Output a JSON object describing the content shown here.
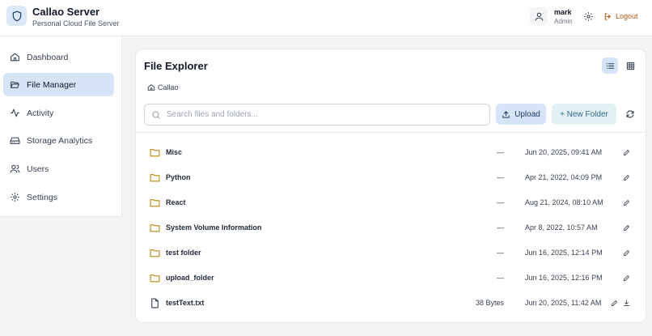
{
  "app": {
    "title": "Callao Server",
    "subtitle": "Personal Cloud File Server"
  },
  "user": {
    "name": "mark",
    "role": "Admin"
  },
  "header": {
    "logout_label": "Logout"
  },
  "sidebar": {
    "items": [
      {
        "label": "Dashboard",
        "icon": "home-icon"
      },
      {
        "label": "File Manager",
        "icon": "folder-open-icon",
        "active": true
      },
      {
        "label": "Activity",
        "icon": "activity-icon"
      },
      {
        "label": "Storage Analytics",
        "icon": "hard-drive-icon"
      },
      {
        "label": "Users",
        "icon": "users-icon"
      },
      {
        "label": "Settings",
        "icon": "gear-icon"
      }
    ]
  },
  "explorer": {
    "title": "File Explorer",
    "breadcrumb": "Callao",
    "search_placeholder": "Search files and folders...",
    "upload_label": "Upload",
    "new_folder_label": "+ New Folder",
    "view_mode": "list"
  },
  "files": [
    {
      "name": "Misc",
      "type": "folder",
      "size": "—",
      "modified": "Jun 20, 2025, 09:41 AM"
    },
    {
      "name": "Python",
      "type": "folder",
      "size": "—",
      "modified": "Apr 21, 2022, 04:09 PM"
    },
    {
      "name": "React",
      "type": "folder",
      "size": "—",
      "modified": "Aug 21, 2024, 08:10 AM"
    },
    {
      "name": "System Volume Information",
      "type": "folder",
      "size": "—",
      "modified": "Apr 8, 2022, 10:57 AM"
    },
    {
      "name": "test folder",
      "type": "folder",
      "size": "—",
      "modified": "Jun 16, 2025, 12:14 PM"
    },
    {
      "name": "upload_folder",
      "type": "folder",
      "size": "—",
      "modified": "Jun 16, 2025, 12:16 PM"
    },
    {
      "name": "testText.txt",
      "type": "file",
      "size": "38 Bytes",
      "modified": "Jun 20, 2025, 11:42 AM"
    }
  ],
  "colors": {
    "accent": "#d5e5f7",
    "folder": "#b8860b",
    "logout": "#b45309"
  }
}
